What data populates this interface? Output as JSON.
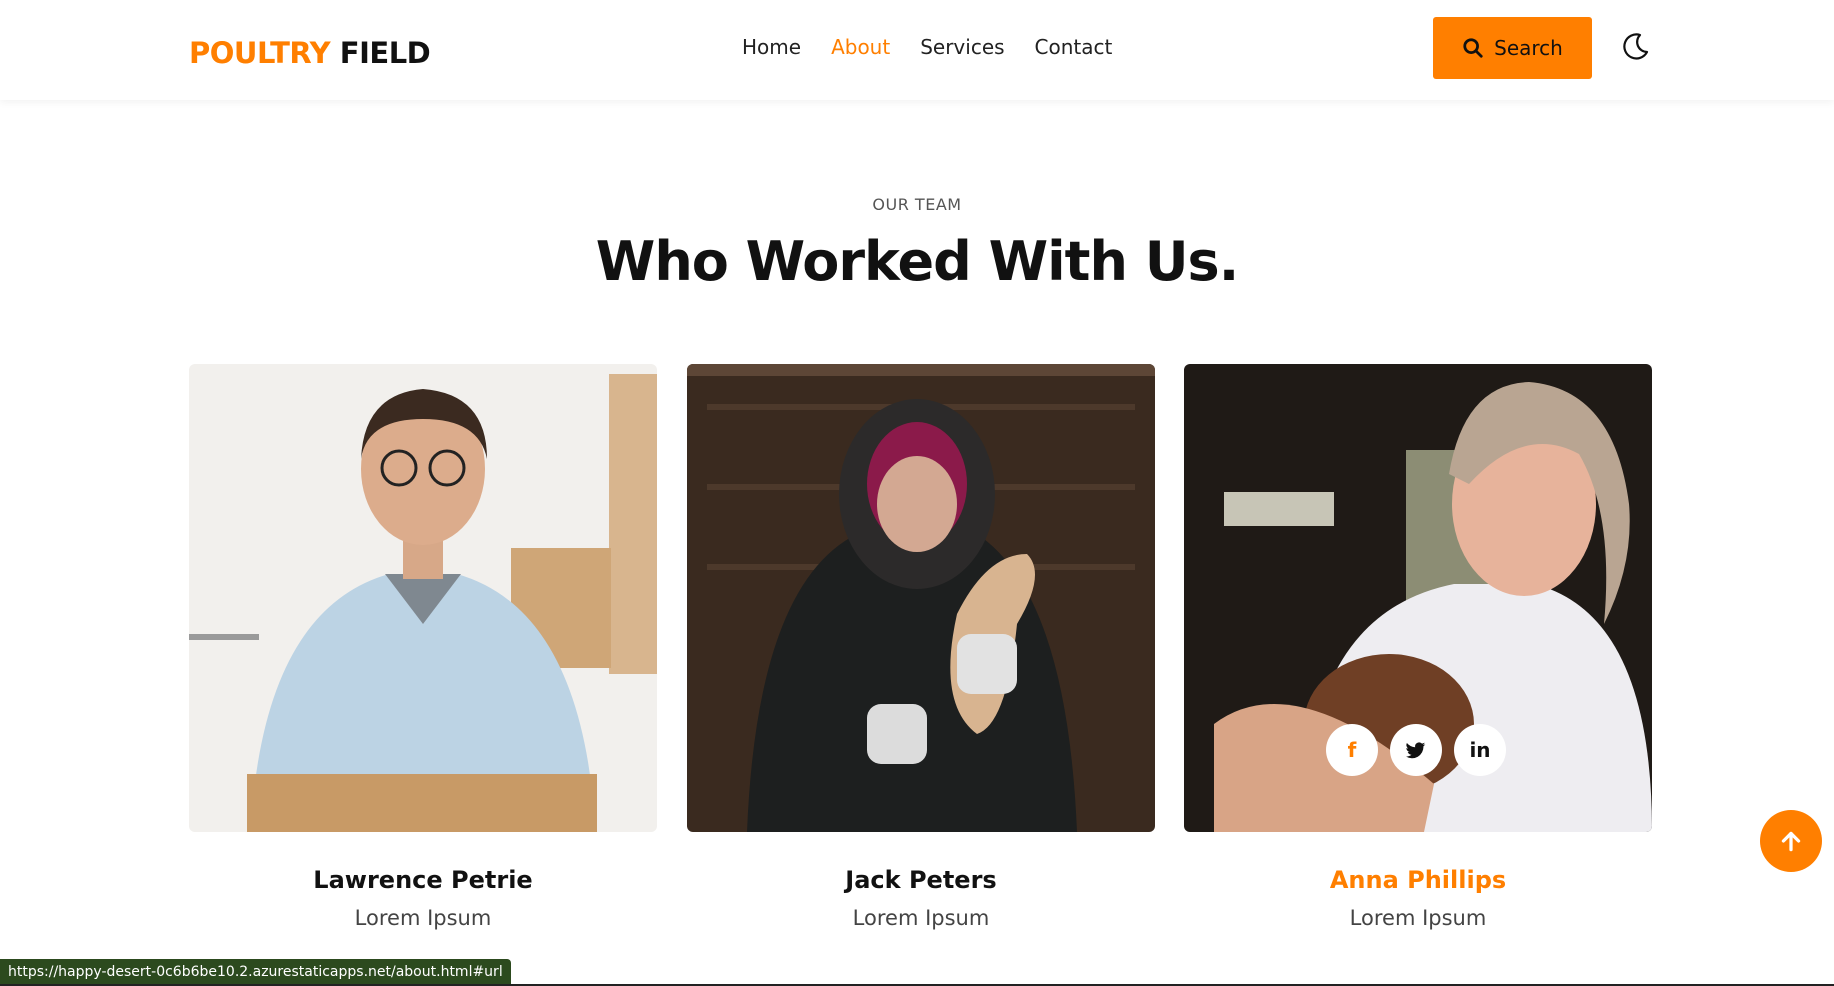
{
  "brand": {
    "part1": "POULTRY",
    "part2": "FIELD"
  },
  "nav": {
    "items": [
      {
        "label": "Home",
        "active": false
      },
      {
        "label": "About",
        "active": true
      },
      {
        "label": "Services",
        "active": false
      },
      {
        "label": "Contact",
        "active": false
      }
    ]
  },
  "header": {
    "search_label": "Search",
    "theme_icon": "moon-icon"
  },
  "section": {
    "eyebrow": "OUR TEAM",
    "title": "Who Worked With Us."
  },
  "team": [
    {
      "name": "Lawrence Petrie",
      "role": "Lorem Ipsum",
      "highlighted": false
    },
    {
      "name": "Jack Peters",
      "role": "Lorem Ipsum",
      "highlighted": false
    },
    {
      "name": "Anna Phillips",
      "role": "Lorem Ipsum",
      "highlighted": true,
      "socials": [
        "facebook-icon",
        "twitter-icon",
        "linkedin-icon"
      ]
    }
  ],
  "status_bar": {
    "url": "https://happy-desert-0c6b6be10.2.azurestaticapps.net/about.html#url"
  },
  "colors": {
    "accent": "#ff7f00",
    "text": "#111111",
    "status_bg": "#2c4a1e"
  }
}
